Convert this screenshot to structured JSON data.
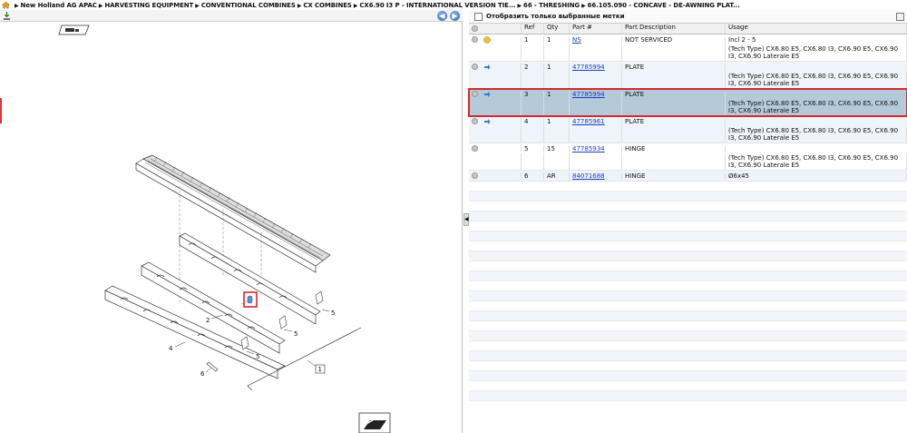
{
  "breadcrumb": {
    "items": [
      "New Holland AG APAC",
      "HARVESTING EQUIPMENT",
      "CONVENTIONAL COMBINES",
      "CX COMBINES",
      "CX6.90 I3 P - INTERNATIONAL VERSION TIE...",
      "66 - THRESHING",
      "66.105.090 - CONCAVE - DE-AWNING PLAT..."
    ],
    "separator": "▶"
  },
  "diagram": {
    "callouts": [
      "1",
      "2",
      "4",
      "5",
      "5",
      "5",
      "6"
    ]
  },
  "filter": {
    "label": "Отобразить только выбранные метки"
  },
  "table": {
    "headers": [
      "Ref",
      "Qty",
      "Part #",
      "Part Description",
      "Usage"
    ],
    "rows": [
      {
        "ref": "1",
        "qty": "1",
        "part": "NS",
        "desc": "NOT SERVICED",
        "usage": "Incl 2 - 5",
        "usage2": "(Tech Type) CX6.80 E5, CX6.80 I3, CX6.90 E5, CX6.90 I3, CX6.90 Laterale E5",
        "badge": "yellow"
      },
      {
        "ref": "2",
        "qty": "1",
        "part": "47785994",
        "desc": "PLATE",
        "usage": "",
        "usage2": "(Tech Type) CX6.80 E5, CX6.80 I3, CX6.90 E5, CX6.90 I3, CX6.90 Laterale E5",
        "badge": "blue"
      },
      {
        "ref": "3",
        "qty": "1",
        "part": "47785994",
        "desc": "PLATE",
        "usage": "",
        "usage2": "(Tech Type) CX6.80 E5, CX6.80 I3, CX6.90 E5, CX6.90 I3, CX6.90 Laterale E5",
        "badge": "blue",
        "selected": true
      },
      {
        "ref": "4",
        "qty": "1",
        "part": "47785961",
        "desc": "PLATE",
        "usage": "",
        "usage2": "(Tech Type) CX6.80 E5, CX6.80 I3, CX6.90 E5, CX6.90 I3, CX6.90 Laterale E5",
        "badge": "blue"
      },
      {
        "ref": "5",
        "qty": "15",
        "part": "47785934",
        "desc": "HINGE",
        "usage": "",
        "usage2": "(Tech Type) CX6.80 E5, CX6.80 I3, CX6.90 E5, CX6.90 I3, CX6.90 Laterale E5",
        "badge": "none"
      },
      {
        "ref": "6",
        "qty": "AR",
        "part": "84071688",
        "desc": "HINGE",
        "usage": "Ø6x45",
        "usage2": "",
        "badge": "none"
      }
    ]
  }
}
